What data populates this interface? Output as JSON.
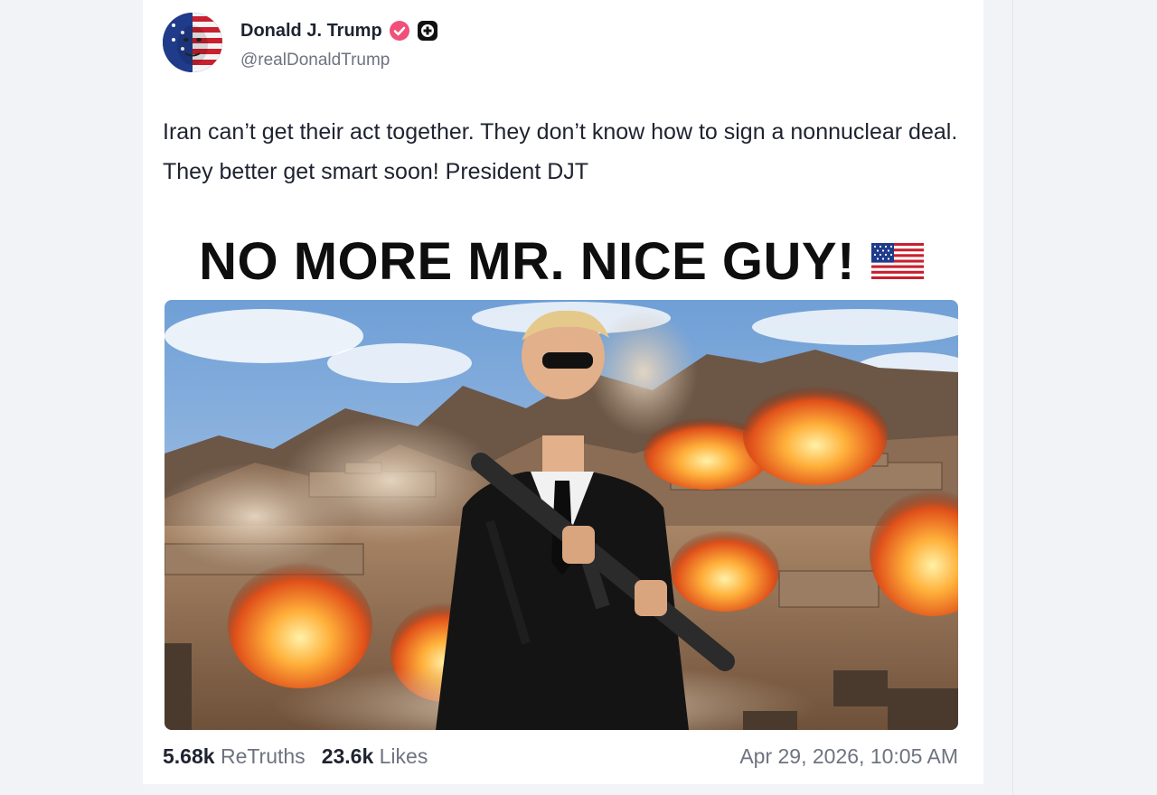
{
  "author": {
    "name": "Donald J. Trump",
    "handle": "@realDonaldTrump",
    "avatar": "avatar-flag-face-icon",
    "verified_color": "#f0507a"
  },
  "post": {
    "text": "Iran can’t get their act together. They don’t know how to sign a nonnuclear deal. They better get smart soon! President DJT",
    "image_headline": "NO MORE MR. NICE GUY!",
    "headline_emoji": "us-flag-icon"
  },
  "stats": {
    "retruths_count": "5.68k",
    "retruths_label": "ReTruths",
    "likes_count": "23.6k",
    "likes_label": "Likes"
  },
  "timestamp": "Apr 29, 2026, 10:05 AM",
  "colors": {
    "page_bg": "#f2f3f7",
    "card_bg": "#ffffff",
    "text": "#1f2330",
    "muted": "#6e7380"
  }
}
